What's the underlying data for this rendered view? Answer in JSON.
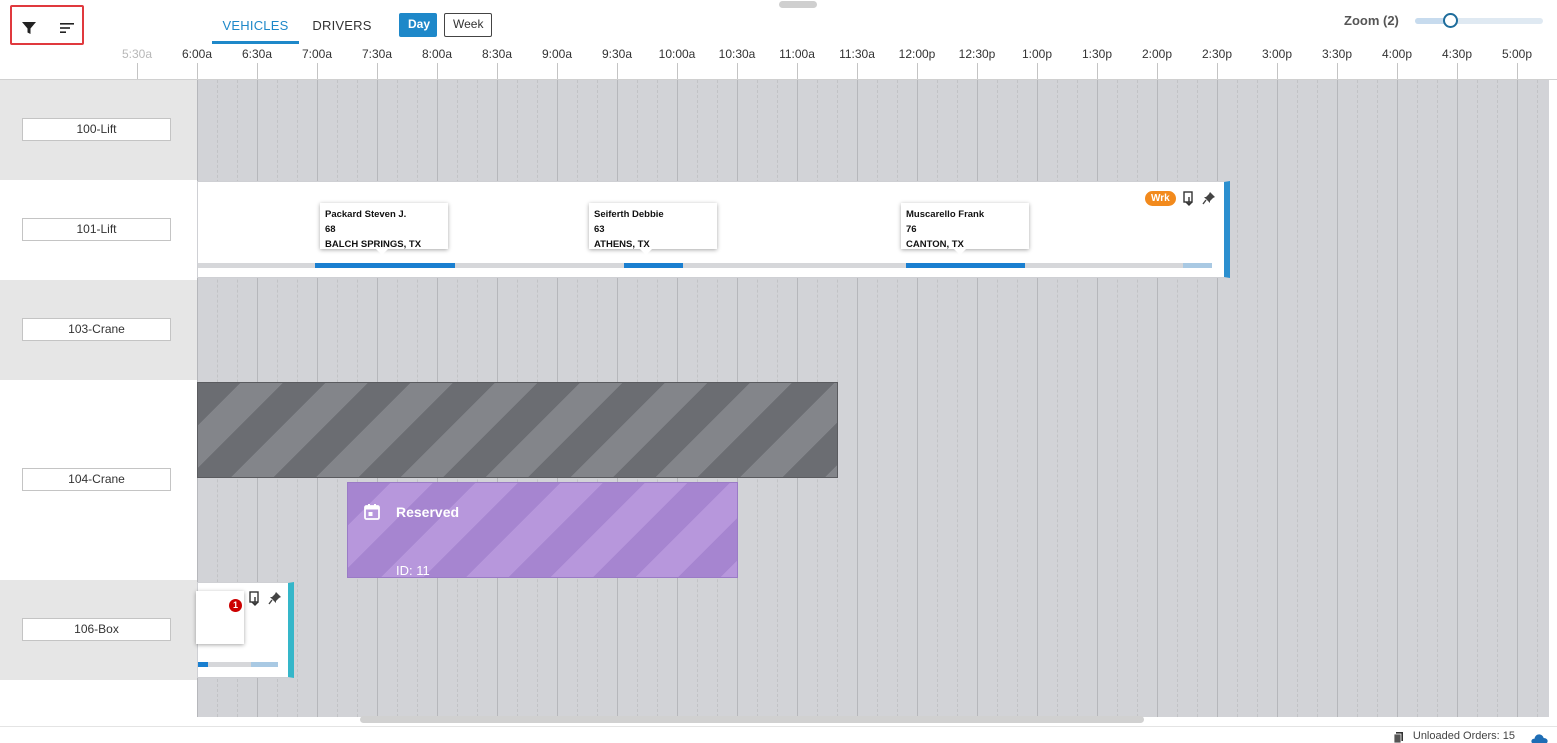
{
  "toolbar": {
    "filter_icon": "filter-icon",
    "sort_icon": "sort-icon"
  },
  "tabs": [
    {
      "label": "VEHICLES",
      "active": true
    },
    {
      "label": "DRIVERS",
      "active": false
    }
  ],
  "view_toggle": {
    "day": "Day",
    "week": "Week",
    "selected": "Day"
  },
  "zoom": {
    "label": "Zoom (2)",
    "level": 2,
    "fraction": 0.27
  },
  "timeline": {
    "ticks": [
      "5:30a",
      "6:00a",
      "6:30a",
      "7:00a",
      "7:30a",
      "8:00a",
      "8:30a",
      "9:00a",
      "9:30a",
      "10:00a",
      "10:30a",
      "11:00a",
      "11:30a",
      "12:00p",
      "12:30p",
      "1:00p",
      "1:30p",
      "2:00p",
      "2:30p",
      "3:00p",
      "3:30p",
      "4:00p",
      "4:30p",
      "5:00p"
    ],
    "first_tick_dim": true
  },
  "rows": [
    {
      "name": "100-Lift"
    },
    {
      "name": "101-Lift"
    },
    {
      "name": "103-Crane"
    },
    {
      "name": "104-Crane"
    },
    {
      "name": "106-Box"
    }
  ],
  "trip_101": {
    "badge": "Wrk",
    "stops": [
      {
        "name": "Packard Steven J.",
        "number": "68",
        "location": "BALCH SPRINGS, TX"
      },
      {
        "name": "Seiferth Debbie",
        "number": "63",
        "location": "ATHENS, TX"
      },
      {
        "name": "Muscarello Frank",
        "number": "76",
        "location": "CANTON, TX"
      }
    ]
  },
  "reserved": {
    "title": "Reserved",
    "id_label": "ID: 11",
    "color": "#a685d0"
  },
  "trip_106": {
    "badge_count": "1"
  },
  "footer": {
    "unloaded_orders": "Unloaded Orders: 15"
  },
  "colors": {
    "accent": "#1e88c9",
    "wrk": "#f28a1d",
    "trip_border": "#2b8fcf",
    "teal": "#35b6c9"
  }
}
